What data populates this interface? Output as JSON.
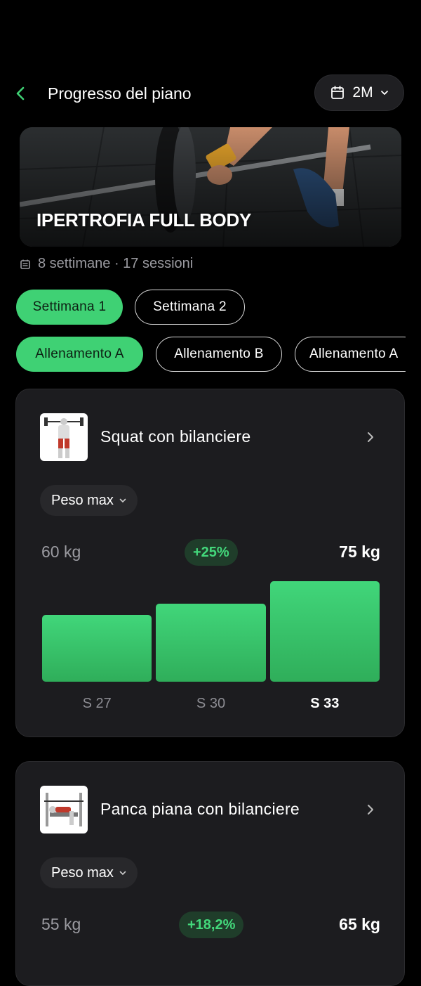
{
  "header": {
    "back_icon": "chevron-left-icon",
    "title": "Progresso del piano",
    "period": {
      "icon": "calendar-icon",
      "label": "2M",
      "dropdown_icon": "chevron-down-icon"
    }
  },
  "plan": {
    "name": "IPERTROFIA FULL BODY",
    "meta_icon": "calendar-small-icon",
    "meta": "8 settimane · 17 sessioni"
  },
  "weeks": [
    {
      "label": "Settimana 1",
      "selected": true
    },
    {
      "label": "Settimana 2",
      "selected": false
    }
  ],
  "workouts": [
    {
      "label": "Allenamento A",
      "selected": true
    },
    {
      "label": "Allenamento B",
      "selected": false
    },
    {
      "label": "Allenamento A",
      "selected": false
    }
  ],
  "exercises": [
    {
      "name": "Squat con bilanciere",
      "metric": "Peso max",
      "start": "60 kg",
      "delta": "+25%",
      "end": "75 kg",
      "chart_data": {
        "type": "bar",
        "categories": [
          "S 27",
          "S 30",
          "S 33"
        ],
        "values": [
          60,
          65,
          75
        ],
        "highlight": "S 33"
      }
    },
    {
      "name": "Panca piana con bilanciere",
      "metric": "Peso max",
      "start": "55 kg",
      "delta": "+18,2%",
      "end": "65 kg"
    }
  ],
  "colors": {
    "accent": "#3fd174",
    "background": "#000000",
    "card": "#1c1c1f"
  }
}
